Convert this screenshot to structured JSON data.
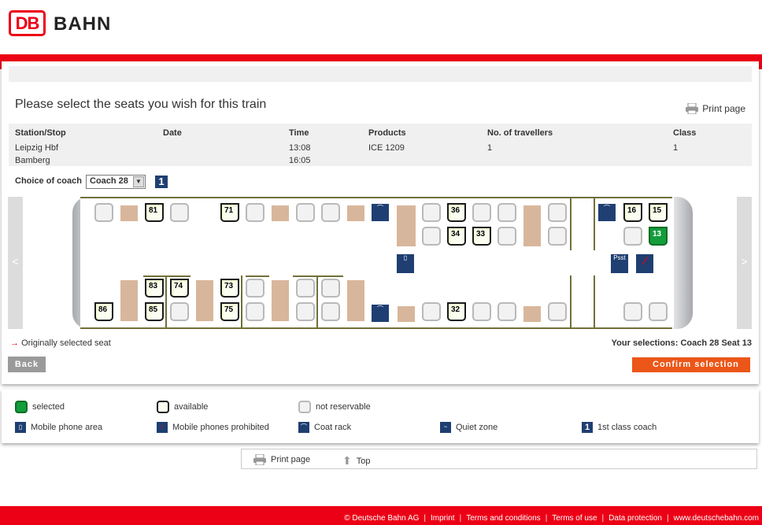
{
  "header": {
    "logo_mark": "DB",
    "logo_text": "BAHN"
  },
  "page": {
    "title": "Please select the seats you wish for this train",
    "print_label": "Print page"
  },
  "journey": {
    "headers": {
      "station": "Station/Stop",
      "date": "Date",
      "time": "Time",
      "products": "Products",
      "travellers": "No. of travellers",
      "class": "Class"
    },
    "from": "Leipzig Hbf",
    "to": "Bamberg",
    "dep_time": "13:08",
    "arr_time": "16:05",
    "product": "ICE 1209",
    "travellers": "1",
    "class": "1"
  },
  "coach": {
    "choice_label": "Choice of coach",
    "selected": "Coach 28",
    "badge": "1"
  },
  "nav": {
    "prev": "<",
    "next": ">"
  },
  "seats": {
    "s81": "81",
    "s71": "71",
    "s36": "36",
    "s34": "34",
    "s33": "33",
    "s16": "16",
    "s15": "15",
    "s13": "13",
    "s83": "83",
    "s74": "74",
    "s73": "73",
    "s86": "86",
    "s85": "85",
    "s75": "75",
    "s32": "32"
  },
  "status": {
    "original_label": "Originally selected seat",
    "selections_label": "Your selections:",
    "selection_coach": "Coach 28",
    "selection_seat": "Seat 13"
  },
  "actions": {
    "back": "Back",
    "confirm": "Confirm selection"
  },
  "legend": {
    "selected": "selected",
    "available": "available",
    "not_reservable": "not reservable",
    "phone_area": "Mobile phone area",
    "phones_prohibited": "Mobile phones prohibited",
    "coat_rack": "Coat rack",
    "quiet_zone": "Quiet zone",
    "first_class": "1st class coach"
  },
  "bottom": {
    "print": "Print page",
    "top": "Top"
  },
  "footer": {
    "copyright": "© Deutsche Bahn AG",
    "links": [
      "Imprint",
      "Terms and conditions",
      "Terms of use",
      "Data protection",
      "www.deutschebahn.com"
    ]
  },
  "colors": {
    "brand_red": "#ec0016",
    "selected_green": "#139d3b",
    "confirm_orange": "#ec5618",
    "icon_blue": "#1f3f72"
  }
}
